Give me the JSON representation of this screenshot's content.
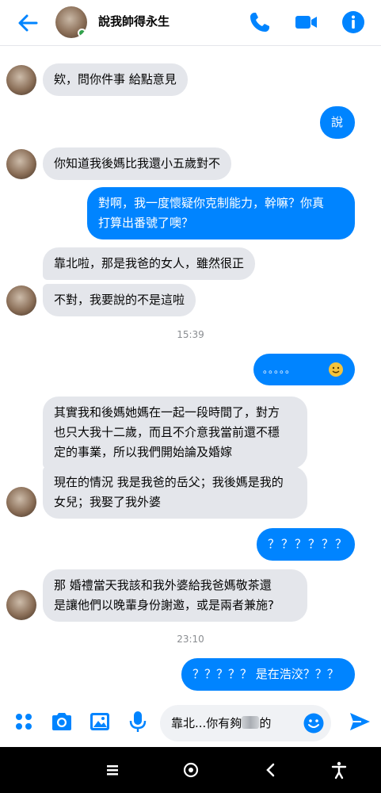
{
  "header": {
    "contact_name": "說我帥得永生"
  },
  "messages": [
    {
      "side": "in",
      "text": "欸，問你件事  給點意見"
    },
    {
      "side": "out",
      "text": "說"
    },
    {
      "side": "in",
      "text": "你知道我後媽比我還小五歲對不"
    },
    {
      "side": "out",
      "lines": [
        "對啊，我一度懷疑你克制能力，幹嘛？你真",
        "打算出番號了噢？"
      ]
    },
    {
      "side": "in",
      "text": "靠北啦，那是我爸的女人，雖然很正"
    },
    {
      "side": "in",
      "text": "不對，我要說的不是這啦"
    },
    {
      "side": "out",
      "text": "。。。。。"
    },
    {
      "side": "in",
      "lines": [
        "其實我和後媽她媽在一起一段時間了，對方",
        "也只大我十二歲，而且不介意我當前還不穩",
        "定的事業，所以我們開始論及婚嫁"
      ]
    },
    {
      "side": "in",
      "lines": [
        "現在的情況 我是我爸的岳父；我後媽是我的",
        "女兒；我娶了我外婆"
      ]
    },
    {
      "side": "out",
      "text": "？？？？？？"
    },
    {
      "side": "in",
      "lines": [
        "那  婚禮當天我該和我外婆給我爸媽敬茶還",
        "是讓他們以晚輩身份謝邀，或是兩者兼施?"
      ]
    },
    {
      "side": "out",
      "text": "？？？？？ 是在浩洨？？？"
    }
  ],
  "timestamps": [
    "15:39",
    "23:10"
  ],
  "composer": {
    "input_value": "靠北...你有夠",
    "input_value_tail": "的"
  },
  "icons": {
    "header": [
      "back-arrow-icon",
      "phone-icon",
      "video-camera-icon",
      "info-icon"
    ],
    "composer": [
      "apps-icon",
      "camera-icon",
      "image-icon",
      "microphone-icon",
      "emoji-icon",
      "send-icon"
    ],
    "navbar": [
      "recent-apps-icon",
      "home-icon",
      "back-icon",
      "accessibility-icon"
    ]
  },
  "colors": {
    "accent": "#0084ff",
    "incoming_bubble": "#e4e6eb",
    "online": "#31a24c",
    "emoji": "#f5c33b"
  }
}
